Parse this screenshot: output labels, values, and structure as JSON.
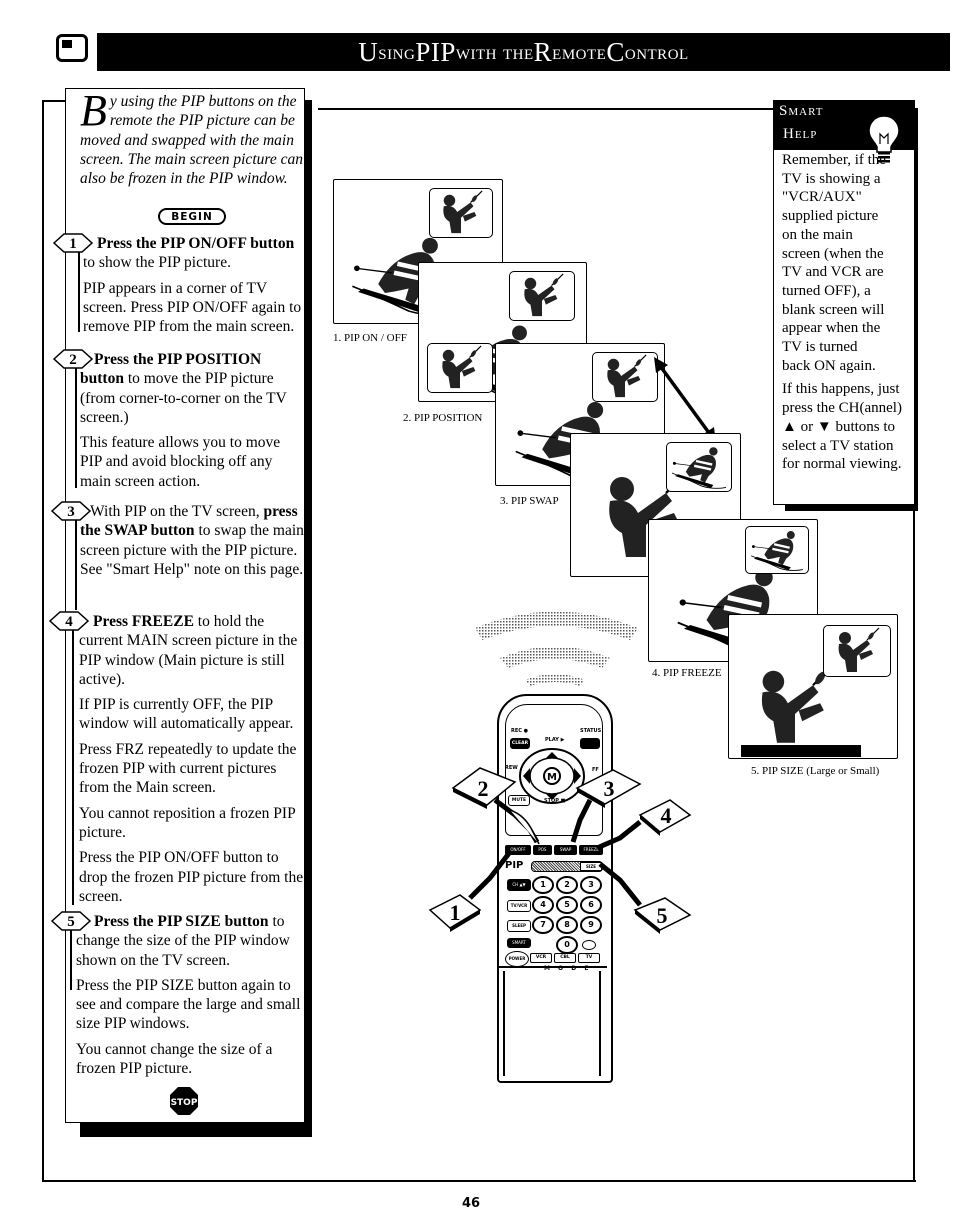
{
  "header": {
    "title_parts": [
      {
        "text": "U",
        "big": true
      },
      {
        "text": "sing ",
        "big": false
      },
      {
        "text": "PIP",
        "big": true
      },
      {
        "text": " with the ",
        "big": false
      },
      {
        "text": "R",
        "big": true
      },
      {
        "text": "emote ",
        "big": false
      },
      {
        "text": "C",
        "big": true
      },
      {
        "text": "ontrol",
        "big": false
      }
    ],
    "title": "Using PIP with the Remote Control",
    "icon": "tv-screen-icon"
  },
  "intro": {
    "dropcap": "B",
    "text": "y using the PIP buttons on the remote the  PIP picture can be moved and swapped with the main screen.  The main screen picture can also be frozen in the PIP window."
  },
  "begin_label": "BEGIN",
  "steps": [
    {
      "number": "1",
      "lead_bold": "Press the PIP ON/OFF button",
      "lead_rest": " to show the PIP picture.",
      "paragraphs": [
        "PIP appears in a corner of TV screen.  Press PIP ON/OFF again to remove PIP from the main screen."
      ]
    },
    {
      "number": "2",
      "lead_bold": "Press the PIP POSITION button",
      "lead_rest": "  to move the PIP picture (from corner-to-corner on the TV screen.)",
      "paragraphs": [
        "This feature allows you to move PIP and avoid blocking off any main screen action."
      ]
    },
    {
      "number": "3",
      "lead_pre": " With PIP on the TV screen, ",
      "lead_bold": "press the SWAP button",
      "lead_rest": " to swap the main screen picture with the PIP picture. See \"Smart Help\" note on this page.",
      "paragraphs": []
    },
    {
      "number": "4",
      "lead_bold": "Press FREEZE",
      "lead_rest": " to hold the current MAIN screen picture in the PIP window (Main picture is still active).",
      "paragraphs": [
        "If PIP is currently OFF, the PIP window will automatically appear.",
        "Press FRZ repeatedly to update the frozen PIP with current pictures from the Main screen.",
        "You cannot reposition a frozen PIP picture.",
        "Press the PIP ON/OFF button to drop the frozen PIP picture from the screen."
      ]
    },
    {
      "number": "5",
      "lead_bold": "Press the PIP SIZE button",
      "lead_rest": " to change the size of the PIP window shown on the TV screen.",
      "paragraphs": [
        "Press the PIP SIZE button again to see and compare the large and small size PIP windows.",
        "You cannot change the size of a frozen PIP picture."
      ]
    }
  ],
  "stop_label": "STOP",
  "smart_help": {
    "title_line1": "Smart",
    "title_line2": "Help",
    "icon": "light-bulb-icon",
    "paragraphs": [
      "Remember, if the TV is showing a \"VCR/AUX\" supplied picture on the main screen (when the TV and VCR are turned OFF), a blank screen will appear when the TV is turned back ON again.",
      "If this happens, just press the CH(annel) ▲ or ▼ buttons to select a TV station for normal viewing."
    ]
  },
  "illustrations": {
    "captions": [
      "1.  PIP ON / OFF",
      "2.  PIP POSITION",
      "3.  PIP SWAP",
      "4. PIP FREEZE",
      "5. PIP SIZE (Large or Small)"
    ]
  },
  "remote": {
    "callouts": [
      "1",
      "2",
      "3",
      "4",
      "5"
    ],
    "top_labels": {
      "rec": "REC ●",
      "clear": "CLEAR",
      "play": "PLAY ▶",
      "status": "STATUS",
      "rew": "REW",
      "menu": "M",
      "ff": "FF",
      "mute": "MUTE",
      "stop": "STOP ■"
    },
    "pip_row": [
      "ON/OFF",
      "POS",
      "SWAP",
      "FREEZE"
    ],
    "pip_label": "PIP",
    "size_label": "SIZE",
    "keypad": [
      "1",
      "2",
      "3",
      "4",
      "5",
      "6",
      "7",
      "8",
      "9",
      "0"
    ],
    "side_keys": [
      "CH ▲▼",
      "TV/VCR",
      "SLEEP",
      "SMART"
    ],
    "power": "POWER",
    "mode_keys": [
      "VCR",
      "CBL",
      "TV"
    ],
    "mode_label": "M O D E"
  },
  "page_number": "46"
}
